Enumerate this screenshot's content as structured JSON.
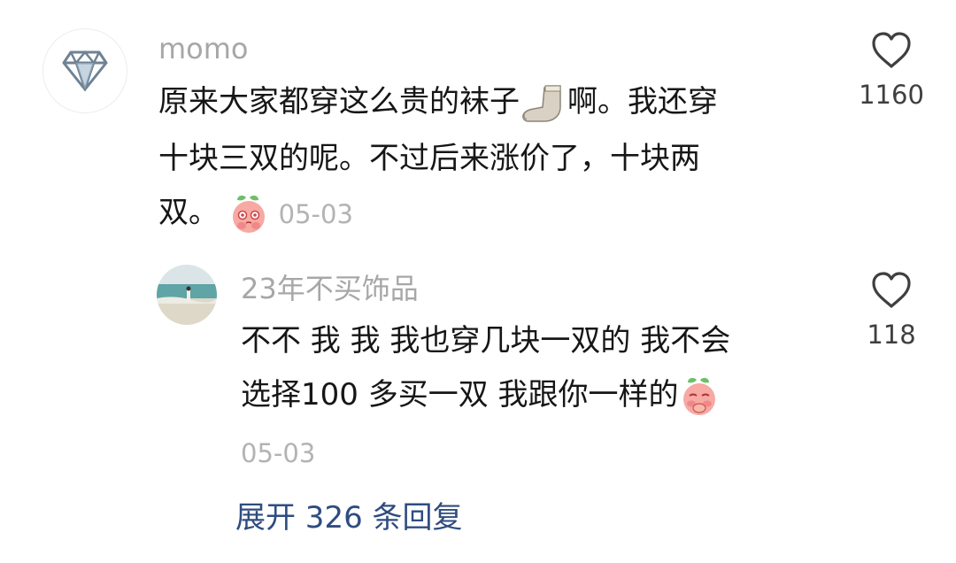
{
  "comment": {
    "username": "momo",
    "lines": [
      "原来大家都穿这么贵的袜子",
      "啊。我还穿",
      "十块三双的呢。不过后来涨价了，十块两",
      "双。"
    ],
    "date": "05-03",
    "like_count": "1160"
  },
  "reply": {
    "username": "23年不买饰品",
    "lines": [
      "不不 我 我 我也穿几块一双的 我不会",
      "选择100 多买一双 我跟你一样的"
    ],
    "date": "05-03",
    "like_count": "118"
  },
  "expand_label": "展开 326 条回复",
  "colors": {
    "username": "#a7a7a7",
    "body_text": "#161616",
    "date": "#b3b3b3",
    "link": "#2f4c80",
    "icon_stroke": "#3f3f3f"
  },
  "icons": [
    "diamond-icon",
    "sock-emoji-icon",
    "peach-emoji-icon",
    "heart-icon"
  ]
}
